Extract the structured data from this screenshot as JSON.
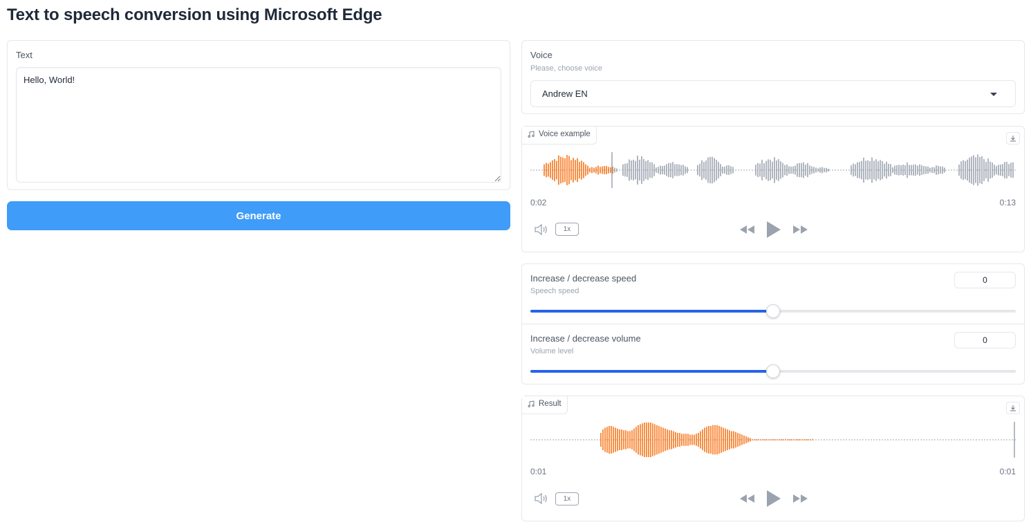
{
  "title": "Text to speech conversion using Microsoft Edge",
  "text_input": {
    "label": "Text",
    "value": "Hello, World!"
  },
  "generate_button": {
    "label": "Generate"
  },
  "voice": {
    "label": "Voice",
    "info": "Please, choose voice",
    "selected": "Andrew EN"
  },
  "voice_example": {
    "label": "Voice example",
    "current_time": "0:02",
    "duration": "0:13",
    "playback_rate": "1x",
    "progress": 0.17,
    "colors": {
      "played": "#f97316",
      "unplayed": "#9ca3af"
    }
  },
  "speed": {
    "label": "Increase / decrease speed",
    "info": "Speech speed",
    "value": "0",
    "min": -100,
    "max": 100,
    "position": 0.5
  },
  "volume": {
    "label": "Increase / decrease volume",
    "info": "Volume level",
    "value": "0",
    "min": -100,
    "max": 100,
    "position": 0.5
  },
  "result": {
    "label": "Result",
    "current_time": "0:01",
    "duration": "0:01",
    "playback_rate": "1x",
    "progress": 1.0,
    "colors": {
      "played": "#f97316",
      "unplayed": "#9ca3af"
    }
  },
  "accent_color": "#3f9cf8",
  "slider_color": "#2563eb",
  "icons": [
    "music-icon",
    "download-icon",
    "volume-icon",
    "rewind-icon",
    "play-icon",
    "fast-forward-icon",
    "chevron-down-icon"
  ]
}
